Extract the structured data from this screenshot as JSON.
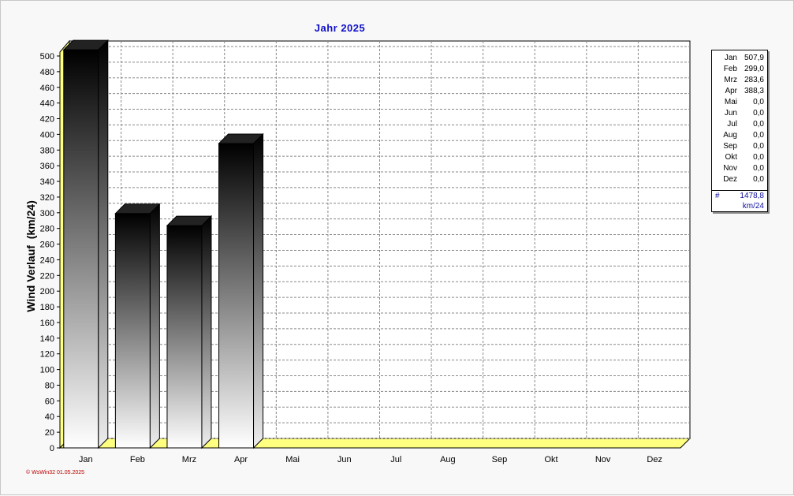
{
  "chart_data": {
    "type": "bar",
    "title": "Jahr  2025",
    "ylabel": "Wind Verlauf  (km/24)",
    "xlabel": "",
    "categories": [
      "Jan",
      "Feb",
      "Mrz",
      "Apr",
      "Mai",
      "Jun",
      "Jul",
      "Aug",
      "Sep",
      "Okt",
      "Nov",
      "Dez"
    ],
    "values": [
      507.9,
      299.0,
      283.6,
      388.3,
      0,
      0,
      0,
      0,
      0,
      0,
      0,
      0
    ],
    "ylim": [
      0,
      500
    ],
    "yticks": [
      "0",
      "20",
      "40",
      "60",
      "80",
      "100",
      "120",
      "140",
      "160",
      "180",
      "200",
      "220",
      "240",
      "260",
      "280",
      "300",
      "320",
      "340",
      "360",
      "380",
      "400",
      "420",
      "440",
      "460",
      "480",
      "500"
    ],
    "grid": true,
    "legend_placement": "right",
    "legend": [
      {
        "month": "Jan",
        "value": "507,9"
      },
      {
        "month": "Feb",
        "value": "299,0"
      },
      {
        "month": "Mrz",
        "value": "283,6"
      },
      {
        "month": "Apr",
        "value": "388,3"
      },
      {
        "month": "Mai",
        "value": "0,0"
      },
      {
        "month": "Jun",
        "value": "0,0"
      },
      {
        "month": "Jul",
        "value": "0,0"
      },
      {
        "month": "Aug",
        "value": "0,0"
      },
      {
        "month": "Sep",
        "value": "0,0"
      },
      {
        "month": "Okt",
        "value": "0,0"
      },
      {
        "month": "Nov",
        "value": "0,0"
      },
      {
        "month": "Dez",
        "value": "0,0"
      }
    ],
    "total_symbol": "#",
    "total": "1478,8",
    "unit": "km/24",
    "footer": "© WsWin32  01.05.2025",
    "colors": {
      "floor": "#ffff80",
      "bar_top": "#000000",
      "bar_bottom": "#ffffff",
      "title": "#1010c8",
      "footer": "#c00000"
    }
  }
}
